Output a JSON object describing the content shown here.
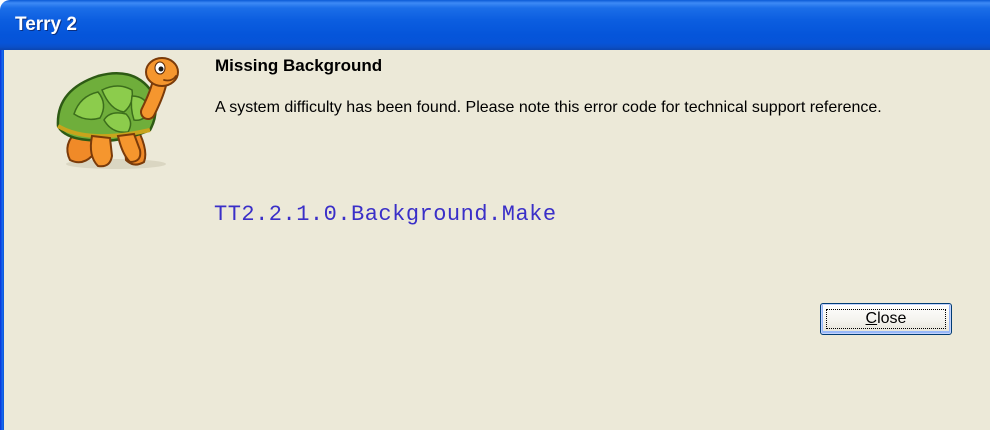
{
  "window": {
    "title": "Terry 2"
  },
  "dialog": {
    "heading": "Missing Background",
    "message": "A system difficulty has been found.  Please note this error code for technical support reference.",
    "error_code": "TT2.2.1.0.Background.Make",
    "icon": "turtle-mascot-icon"
  },
  "buttons": {
    "close_mnemonic": "C",
    "close_rest": "lose"
  },
  "colors": {
    "titlebar": "#0554d8",
    "client_background": "#ece9d8",
    "error_code_text": "#3a2fc8"
  }
}
